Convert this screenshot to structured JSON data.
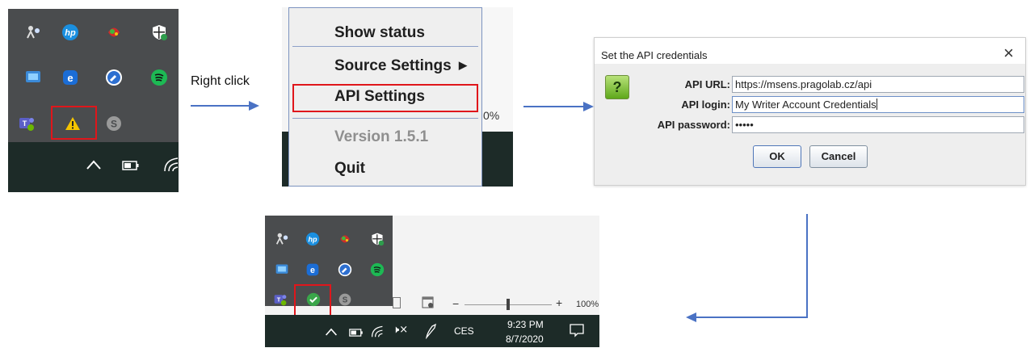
{
  "step_label": "Right click",
  "context_menu": {
    "items": [
      "Show status",
      "Source Settings",
      "API Settings",
      "Version 1.5.1",
      "Quit"
    ],
    "submenu_arrow": "▶",
    "partial_text": "0%"
  },
  "dialog": {
    "title": "Set the API credentials",
    "close_glyph": "×",
    "help_glyph": "?",
    "url_label": "API URL:",
    "url_value": "https://msens.pragolab.cz/api",
    "login_label": "API login:",
    "login_value": "My Writer Account Credentials",
    "password_label": "API password:",
    "password_value": "•••••",
    "ok_label": "OK",
    "cancel_label": "Cancel"
  },
  "result_taskbar": {
    "zoom_minus": "−",
    "zoom_plus": "+",
    "zoom_level": "100%",
    "volume_glyph": "🕨×",
    "language": "CES",
    "time": "9:23 PM",
    "date": "8/7/2020"
  },
  "colors": {
    "highlight": "#e0161b",
    "arrow": "#4a72c4",
    "tray_bg": "#4a4c4e",
    "taskbar_bg": "#1d2b28",
    "warning": "#f5c400",
    "success": "#3aa64a"
  }
}
